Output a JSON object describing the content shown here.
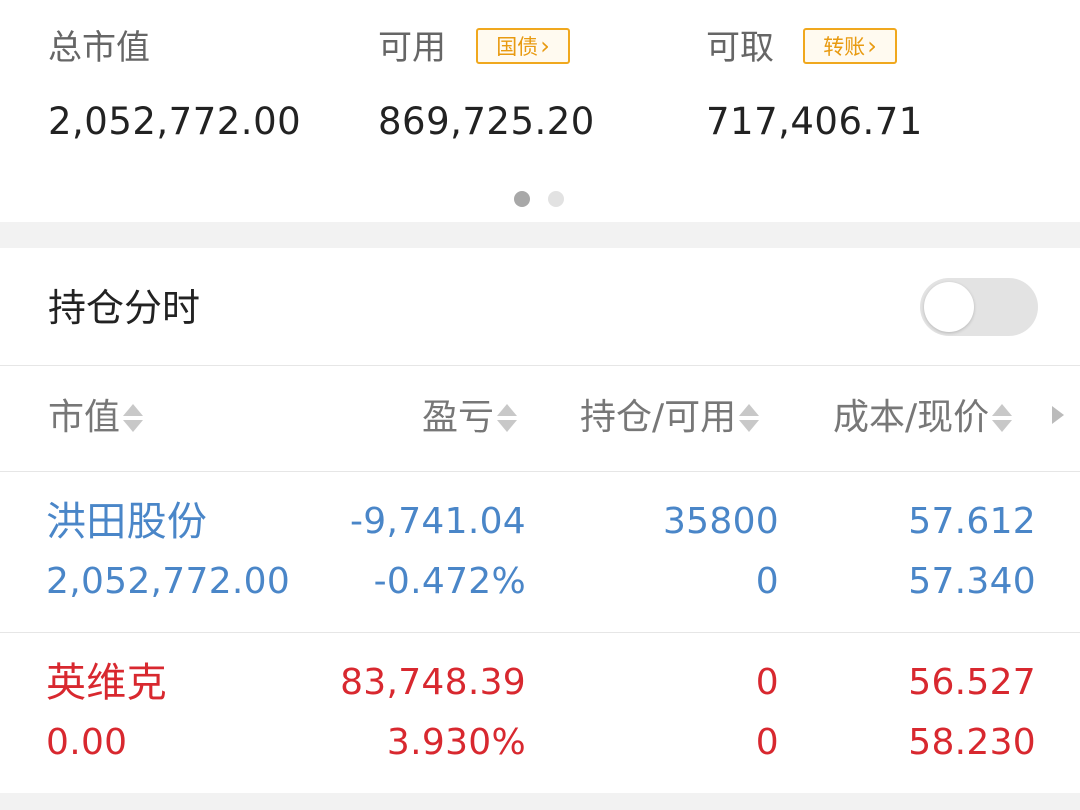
{
  "summary": {
    "total_label": "总市值",
    "total_value": "2,052,772.00",
    "available_label": "可用",
    "available_value": "869,725.20",
    "bond_button": "国债",
    "withdrawable_label": "可取",
    "withdrawable_value": "717,406.71",
    "transfer_button": "转账",
    "page_index": 1,
    "page_count": 2
  },
  "toggle": {
    "label": "持仓分时",
    "on": false
  },
  "table": {
    "headers": [
      "市值",
      "盈亏",
      "持仓/可用",
      "成本/现价"
    ],
    "rows": [
      {
        "name": "洪田股份",
        "market_value": "2,052,772.00",
        "pnl": "-9,741.04",
        "pnl_pct": "-0.472%",
        "position": "35800",
        "available": "0",
        "cost": "57.612",
        "price": "57.340",
        "color": "#4a86c8"
      },
      {
        "name": "英维克",
        "market_value": "0.00",
        "pnl": "83,748.39",
        "pnl_pct": "3.930%",
        "position": "0",
        "available": "0",
        "cost": "56.527",
        "price": "58.230",
        "color": "#d8282f"
      }
    ]
  },
  "colors": {
    "accent_orange": "#f0a81e",
    "loss_blue": "#4a86c8",
    "gain_red": "#d8282f"
  }
}
